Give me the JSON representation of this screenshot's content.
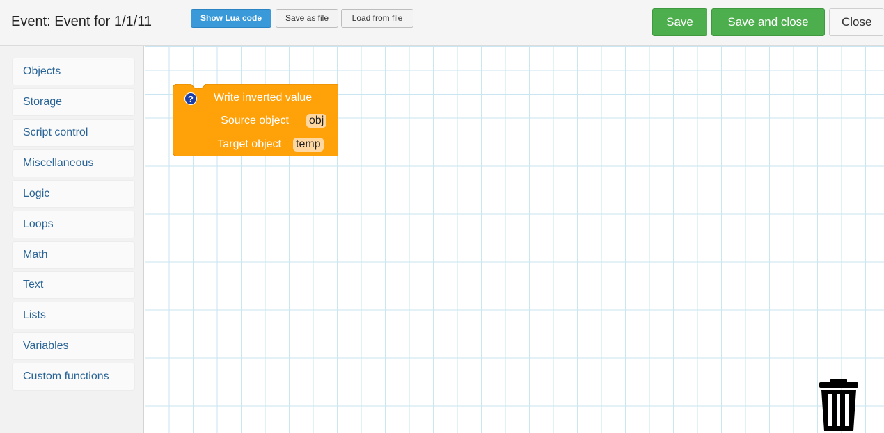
{
  "header": {
    "title": "Event: Event for 1/1/11",
    "show_lua_label": "Show Lua code",
    "save_as_file_label": "Save as file",
    "load_from_file_label": "Load from file",
    "save_label": "Save",
    "save_and_close_label": "Save and close",
    "close_label": "Close"
  },
  "sidebar": {
    "items": [
      {
        "label": "Objects"
      },
      {
        "label": "Storage"
      },
      {
        "label": "Script control"
      },
      {
        "label": "Miscellaneous"
      },
      {
        "label": "Logic"
      },
      {
        "label": "Loops"
      },
      {
        "label": "Math"
      },
      {
        "label": "Text"
      },
      {
        "label": "Lists"
      },
      {
        "label": "Variables"
      },
      {
        "label": "Custom functions"
      }
    ]
  },
  "workspace": {
    "block": {
      "help_icon": "?",
      "title": "Write inverted value",
      "source_label": "Source object",
      "source_value": "obj",
      "target_label": "Target object",
      "target_value": "temp",
      "color": "#ffa109"
    },
    "trash_icon": "trash-icon"
  },
  "colors": {
    "accent_blue": "#3a9ad9",
    "save_green": "#4cae4c",
    "sidebar_link": "#2a6496",
    "grid_line": "#c9e6f2"
  }
}
